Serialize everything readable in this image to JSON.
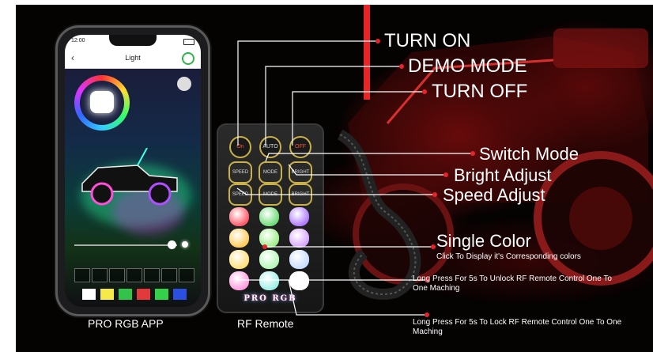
{
  "phone": {
    "status_time": "12:00",
    "app_title": "Light",
    "caption": "PRO RGB APP",
    "swatch_colors": [
      "#ffffff",
      "#f6e94a",
      "#33c24a",
      "#e23a3a",
      "#34d04a",
      "#2b4fe0"
    ]
  },
  "remote": {
    "caption": "RF Remote",
    "brand": "PRO RGB",
    "row1": [
      "On",
      "AUTO",
      "OFF"
    ],
    "row2": [
      "SPEED",
      "MODE",
      "BRIGHT"
    ],
    "row3": [
      "SPEED",
      "MODE",
      "BRIGHT"
    ],
    "color_buttons": [
      "#ff5a6a",
      "#6fdc7a",
      "#b07bff",
      "#ffcb5a",
      "#9ff08a",
      "#d8a6ff",
      "#ffe07a",
      "#b6f6b6",
      "#c8dcff",
      "#ff9ee0",
      "#9ff0e6",
      "#ffffff"
    ]
  },
  "callouts": {
    "turn_on": "TURN ON",
    "demo_mode": "DEMO MODE",
    "turn_off": "TURN OFF",
    "switch_mode": "Switch Mode",
    "bright_adjust": "Bright Adjust",
    "speed_adjust": "Speed Adjust",
    "single_color": "Single Color",
    "single_color_sub": "Click To Display it's Corresponding colors",
    "unlock_note": "Long Press For 5s To Unlock RF Remote Control One To One Maching",
    "lock_note": "Long Press For 5s To Lock RF Remote Control One To One Maching"
  },
  "colors": {
    "accent_red": "#e8232b",
    "line": "#ffffff"
  }
}
